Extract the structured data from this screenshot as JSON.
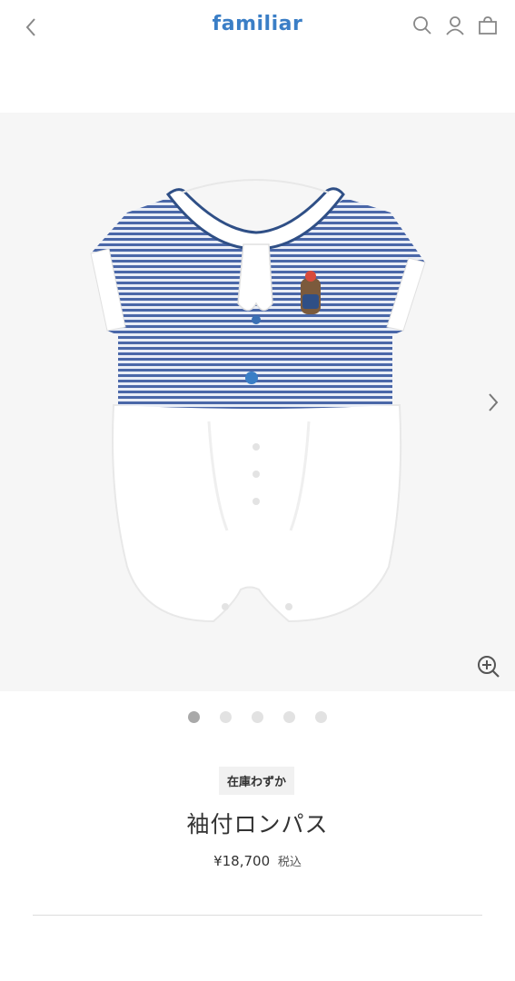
{
  "header": {
    "logo": "familiar",
    "icons": [
      "back-chevron-icon",
      "search-icon",
      "user-icon",
      "bag-icon"
    ],
    "brand_color": "#3a7ec6"
  },
  "gallery": {
    "slide_count": 5,
    "active_slide": 1,
    "icons": [
      "chevron-right-icon",
      "zoom-in-icon"
    ],
    "background": "#f6f6f6",
    "romper_stripe_color": "#4a67a8",
    "romper_body_color": "#ffffff"
  },
  "product": {
    "stock_badge": "在庫わずか",
    "title": "袖付ロンパス",
    "price": "¥18,700",
    "tax_note": "税込"
  }
}
